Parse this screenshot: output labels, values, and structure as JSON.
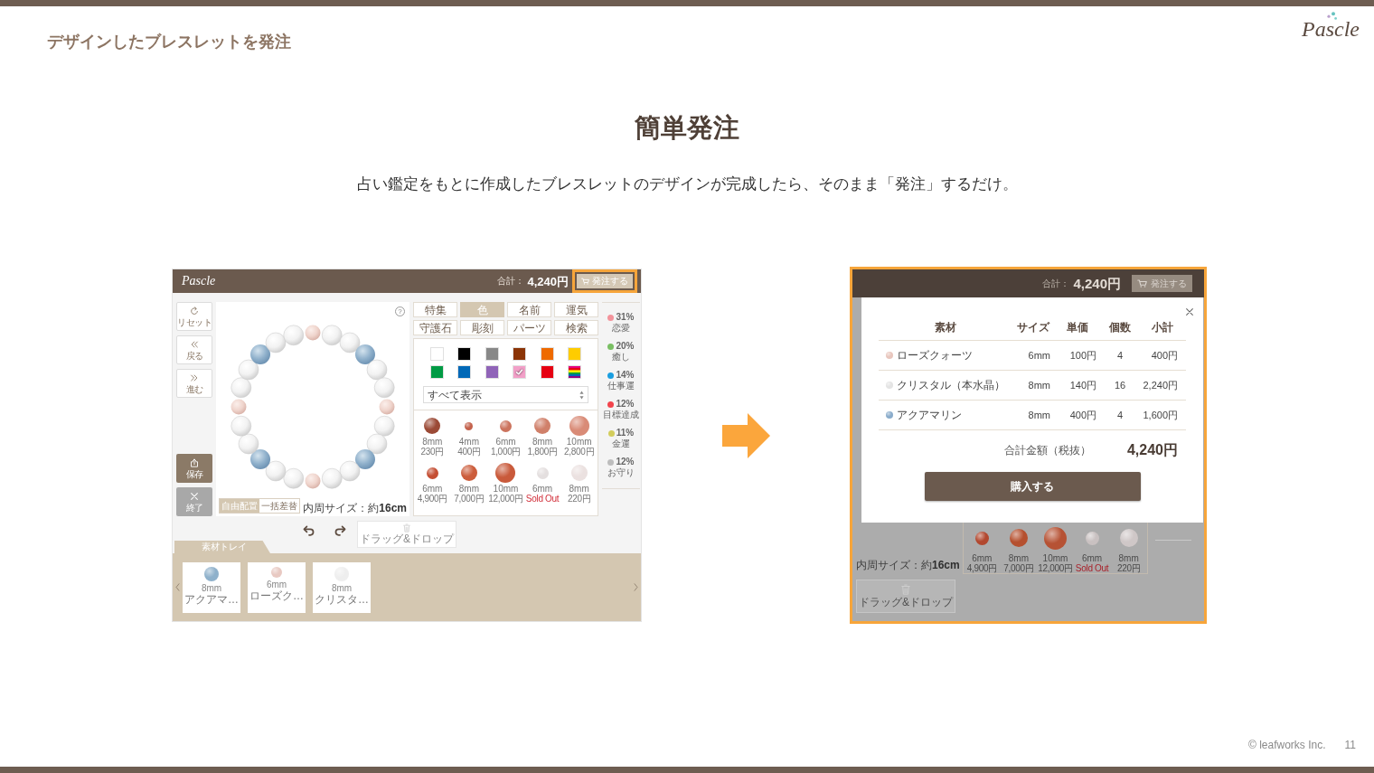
{
  "slide": {
    "title": "デザインしたブレスレットを発注",
    "logo": "Pascle",
    "heading": "簡単発注",
    "lead": "占い鑑定をもとに作成したブレスレットのデザインが完成したら、そのまま「発注」するだけ。",
    "copyright": "© leafworks Inc.",
    "page_number": "11"
  },
  "editor": {
    "header": {
      "logo": "Pascle",
      "total_label": "合計：",
      "total": "4,240円",
      "order_button": "発注する",
      "highlighted": true
    },
    "tools": [
      {
        "kind": "reset",
        "label": "リセット"
      },
      {
        "kind": "back",
        "label": "戻る"
      },
      {
        "kind": "forward",
        "label": "進む"
      }
    ],
    "file_tools": [
      {
        "kind": "save",
        "label": "保存"
      },
      {
        "kind": "exit",
        "label": "終了"
      }
    ],
    "help": "?",
    "layout_modes": [
      {
        "label": "自由配置",
        "selected": true
      },
      {
        "label": "一括差替",
        "selected": false
      }
    ],
    "inner_size": "内周サイズ：約**16cm**",
    "category_tabs": [
      {
        "label": "特集",
        "selected": false
      },
      {
        "label": "色",
        "selected": true
      },
      {
        "label": "名前",
        "selected": false
      },
      {
        "label": "運気",
        "selected": false
      },
      {
        "label": "守護石",
        "selected": false
      },
      {
        "label": "彫刻",
        "selected": false
      },
      {
        "label": "パーツ",
        "selected": false
      },
      {
        "label": "検索",
        "selected": false
      }
    ],
    "color_swatches": [
      {
        "kind": "solid",
        "color": "#ffffff",
        "checked": false
      },
      {
        "kind": "solid",
        "color": "#000000",
        "checked": false
      },
      {
        "kind": "solid",
        "color": "#888888",
        "checked": false
      },
      {
        "kind": "solid",
        "color": "#8b3406",
        "checked": false
      },
      {
        "kind": "solid",
        "color": "#ee6a00",
        "checked": false
      },
      {
        "kind": "solid",
        "color": "#ffcc00",
        "checked": false
      },
      {
        "kind": "solid",
        "color": "#009a44",
        "checked": false
      },
      {
        "kind": "solid",
        "color": "#0068b7",
        "checked": false
      },
      {
        "kind": "solid",
        "color": "#9064b8",
        "checked": false
      },
      {
        "kind": "solid",
        "color": "#f2a0c8",
        "checked": true
      },
      {
        "kind": "solid",
        "color": "#e60012",
        "checked": false
      },
      {
        "kind": "rainbow",
        "checked": false
      }
    ],
    "filter_select": "すべて表示",
    "beads": [
      {
        "size": "8mm",
        "price": "230円",
        "sold_out": false,
        "color": "#9b4a36"
      },
      {
        "size": "4mm",
        "price": "400円",
        "sold_out": false,
        "color": "#c4624c"
      },
      {
        "size": "6mm",
        "price": "1,000円",
        "sold_out": false,
        "color": "#cc735d"
      },
      {
        "size": "8mm",
        "price": "1,800円",
        "sold_out": false,
        "color": "#d0806a"
      },
      {
        "size": "10mm",
        "price": "2,800円",
        "sold_out": false,
        "color": "#d98b77"
      },
      {
        "size": "6mm",
        "price": "4,900円",
        "sold_out": false,
        "color": "#c44e33"
      },
      {
        "size": "8mm",
        "price": "7,000円",
        "sold_out": false,
        "color": "#cc5d3c"
      },
      {
        "size": "10mm",
        "price": "12,000円",
        "sold_out": false,
        "color": "#c95a3b"
      },
      {
        "size": "6mm",
        "price": "Sold Out",
        "sold_out": true,
        "color": "#e4dfdf"
      },
      {
        "size": "8mm",
        "price": "220円",
        "sold_out": false,
        "color": "#ebe1e0"
      }
    ],
    "fortune": [
      {
        "percent": "31%",
        "label": "恋愛",
        "color": "#f3939b"
      },
      {
        "percent": "20%",
        "label": "癒し",
        "color": "#79bf63"
      },
      {
        "percent": "14%",
        "label": "仕事運",
        "color": "#1a9ee0"
      },
      {
        "percent": "12%",
        "label": "目標達成",
        "color": "#f2444c"
      },
      {
        "percent": "11%",
        "label": "金運",
        "color": "#d3cd5c"
      },
      {
        "percent": "12%",
        "label": "お守り",
        "color": "#bdbdbd"
      }
    ],
    "drop_zone": "ドラッグ&ドロップ",
    "tray": {
      "tab": "素材トレイ",
      "items": [
        {
          "size": "8mm",
          "name": "アクアマ…",
          "color": "#8fb1cb"
        },
        {
          "size": "6mm",
          "name": "ローズク…",
          "color": "#e8c9c2"
        },
        {
          "size": "8mm",
          "name": "クリスタ…",
          "color": "#eeeeee"
        }
      ]
    }
  },
  "order": {
    "header": {
      "total_label": "合計：",
      "total": "4,240円",
      "order_button": "発注する"
    },
    "modal": {
      "columns": [
        "素材",
        "サイズ",
        "単価",
        "個数",
        "小計"
      ],
      "rows": [
        {
          "material": "ローズクォーツ",
          "color": "#e8c6bd",
          "size": "6mm",
          "unit_price": "100円",
          "quantity": "4",
          "subtotal": "400円"
        },
        {
          "material": "クリスタル（本水晶）",
          "color": "#e4e4e4",
          "size": "8mm",
          "unit_price": "140円",
          "quantity": "16",
          "subtotal": "2,240円"
        },
        {
          "material": "アクアマリン",
          "color": "#8aaccb",
          "size": "8mm",
          "unit_price": "400円",
          "quantity": "4",
          "subtotal": "1,600円"
        }
      ],
      "total_label": "合計金額（税抜）",
      "total": "4,240円",
      "purchase_button": "購入する"
    },
    "background": {
      "inner_size": "内周サイズ：約**16cm**",
      "drop_zone": "ドラッグ&ドロップ",
      "beads": [
        {
          "size": "6mm",
          "price": "4,900円",
          "sold_out": false,
          "color": "#b2482f"
        },
        {
          "size": "8mm",
          "price": "7,000円",
          "sold_out": false,
          "color": "#b5502f"
        },
        {
          "size": "10mm",
          "price": "12,000円",
          "sold_out": false,
          "color": "#b65234"
        },
        {
          "size": "6mm",
          "price": "Sold Out",
          "sold_out": true,
          "color": "#c9c1c1"
        },
        {
          "size": "8mm",
          "price": "220円",
          "sold_out": false,
          "color": "#cfc7c7"
        }
      ]
    }
  }
}
